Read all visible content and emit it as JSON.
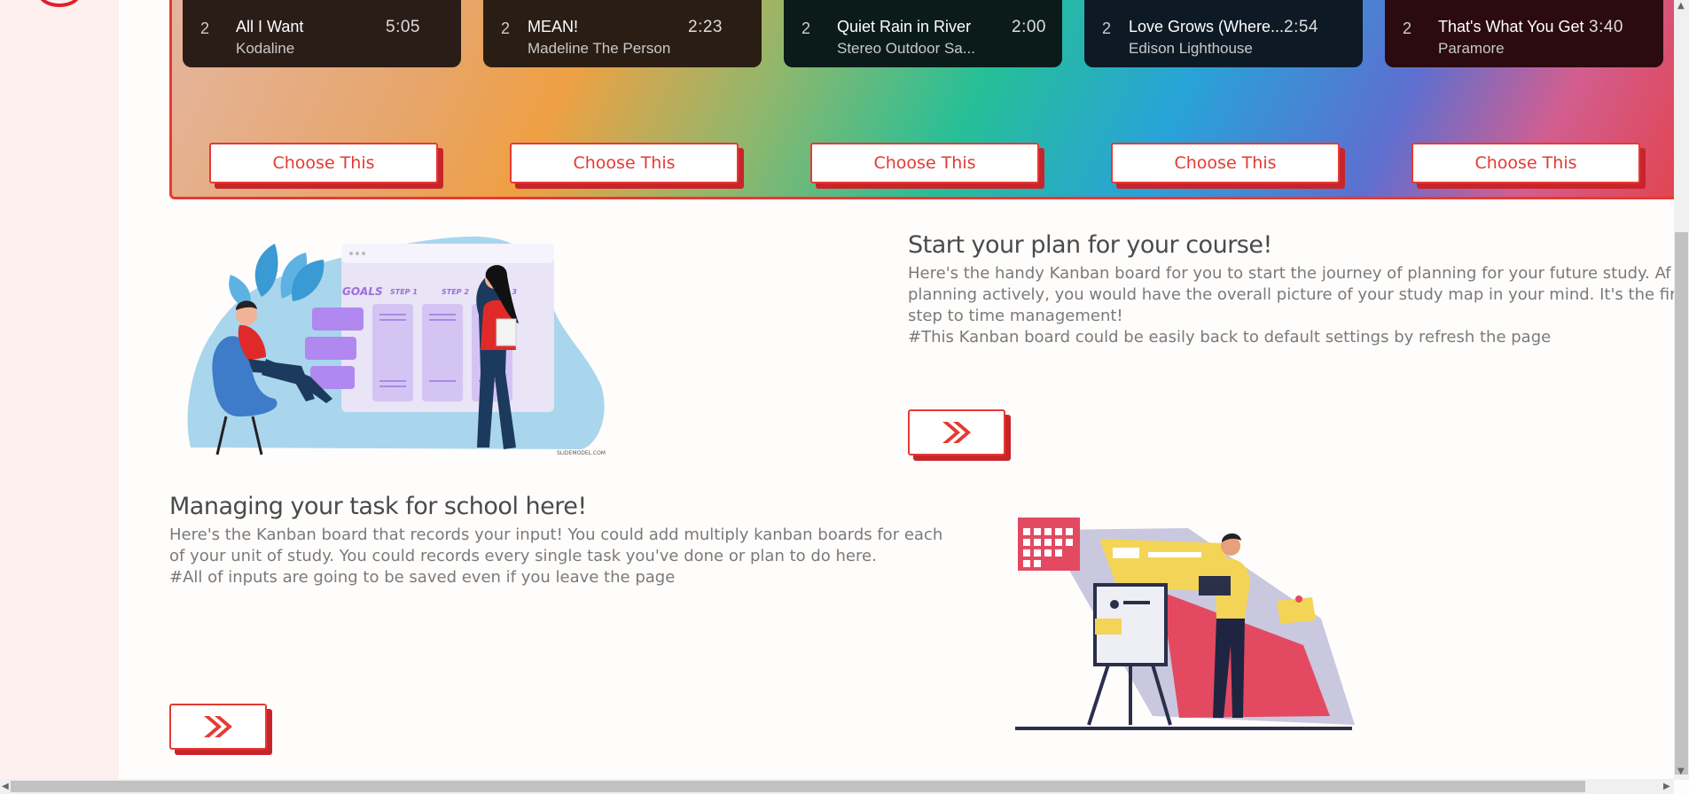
{
  "tracks": [
    {
      "num": "2",
      "title": "All I Want",
      "artist": "Kodaline",
      "duration": "5:05",
      "bg": "#2a1d18"
    },
    {
      "num": "2",
      "title": "MEAN!",
      "artist": "Madeline The Person",
      "duration": "2:23",
      "bg": "#2a1e14"
    },
    {
      "num": "2",
      "title": "Quiet Rain in River",
      "artist": "Stereo Outdoor Sa...",
      "duration": "2:00",
      "bg": "#0b1b1a"
    },
    {
      "num": "2",
      "title": "Love Grows (Where...",
      "artist": "Edison Lighthouse",
      "duration": "2:54",
      "bg": "#0d1a26"
    },
    {
      "num": "2",
      "title": "That's What You Get",
      "artist": "Paramore",
      "duration": "3:40",
      "bg": "#2b0a10"
    }
  ],
  "choose_label": "Choose This",
  "plan": {
    "heading": "Start your plan for your course!",
    "lines": [
      "Here's the handy Kanban board for you to start the journey of planning for your future study. Af",
      "planning actively, you would have the overall picture of your study map in your mind. It's the firs",
      "step to time management!",
      "#This Kanban board could be easily back to default settings by refresh the page"
    ]
  },
  "manage": {
    "heading": "Managing your task for school here!",
    "lines": [
      "Here's the Kanban board that records your input! You could add multiply kanban boards for each",
      "of your unit of study. You could records every single task you've done or plan to do here.",
      "#All of inputs are going to be saved even if you leave the page"
    ]
  },
  "illustration": {
    "goals_label": "GOALS",
    "step1": "STEP 1",
    "step2": "STEP 2",
    "step3": "STEP 3",
    "credit": "SLIDEMODEL.COM"
  },
  "colors": {
    "accent": "#e63a33",
    "shadow": "#c8242b",
    "heading": "#4a4a4a",
    "text": "#7a7a7a"
  },
  "icons": {
    "next": "double-chevron-right-icon"
  }
}
